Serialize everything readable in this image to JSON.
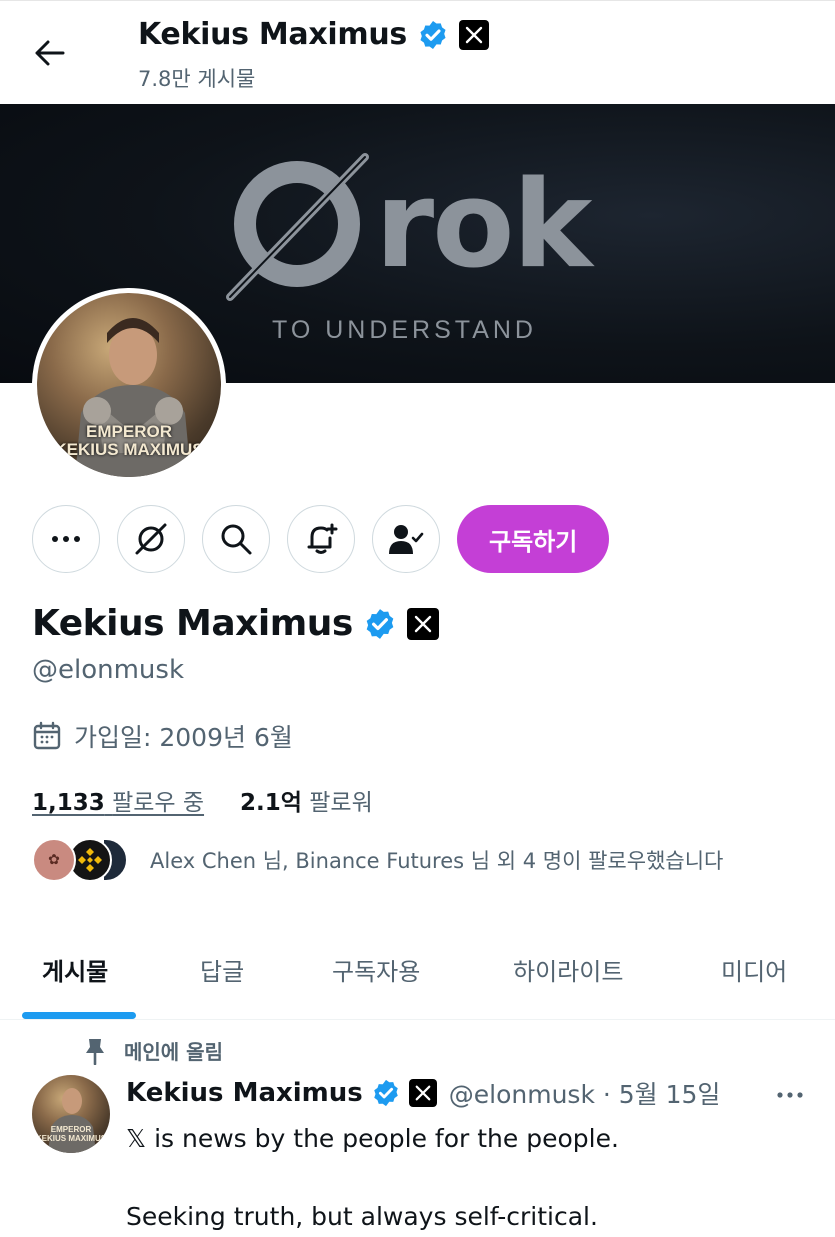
{
  "header": {
    "name": "Kekius Maximus",
    "post_count": "7.8만 게시물"
  },
  "banner": {
    "word": "rok",
    "tagline": "TO UNDERSTAND"
  },
  "avatar": {
    "line1": "EMPEROR",
    "line2": "KEKIUS MAXIMUS"
  },
  "actions": {
    "more_icon": "more-icon",
    "grok_icon": "grok-icon",
    "search_icon": "search-icon",
    "notify_icon": "bell-plus-icon",
    "follow_icon": "following-person-icon",
    "subscribe_label": "구독하기",
    "subscribe_color": "#c43fd6"
  },
  "profile": {
    "name": "Kekius Maximus",
    "handle": "@elonmusk",
    "joined": "가입일: 2009년 6월",
    "following_count": "1,133",
    "following_label": "팔로우 중",
    "followers_count": "2.1억",
    "followers_label": "팔로워",
    "followed_by": "Alex Chen 님, Binance Futures 님 외 4 명이 팔로우했습니다"
  },
  "tabs": [
    {
      "label": "게시물",
      "active": true
    },
    {
      "label": "답글",
      "active": false
    },
    {
      "label": "구독자용",
      "active": false
    },
    {
      "label": "하이라이트",
      "active": false
    },
    {
      "label": "미디어",
      "active": false
    }
  ],
  "post": {
    "pinned_label": "메인에 올림",
    "author": "Kekius Maximus",
    "meta": "@elonmusk · 5월 15일",
    "line1": "𝕏 is news by the people for the people.",
    "line2": "Seeking truth, but always self-critical."
  },
  "colors": {
    "verified": "#1d9bf0",
    "accent": "#1d9bf0",
    "muted_text": "#536471"
  }
}
